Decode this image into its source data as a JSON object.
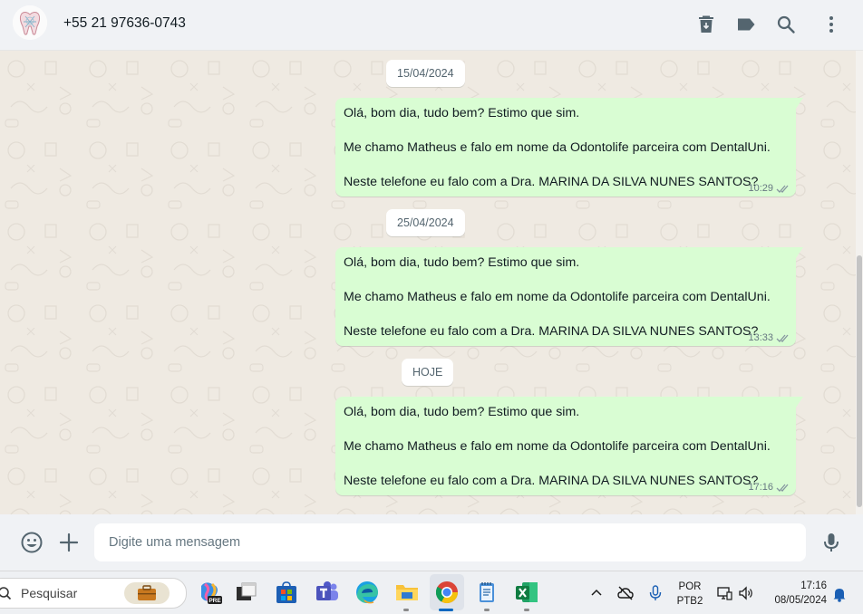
{
  "header": {
    "contact_name": "+55 21 97636-0743",
    "icons": [
      "delete-chat-icon",
      "label-icon",
      "search-icon",
      "menu-icon"
    ]
  },
  "chat": {
    "groups": [
      {
        "date": "15/04/2024",
        "message": {
          "lines": [
            "Olá, bom dia, tudo bem? Estimo que sim.",
            "Me chamo Matheus e falo em nome da Odontolife parceira com DentalUni.",
            "Neste telefone eu falo com a Dra. MARINA DA SILVA NUNES SANTOS?"
          ],
          "time": "10:29",
          "status": "delivered"
        }
      },
      {
        "date": "25/04/2024",
        "message": {
          "lines": [
            "Olá, bom dia, tudo bem? Estimo que sim.",
            "Me chamo Matheus e falo em nome da Odontolife parceira com DentalUni.",
            "Neste telefone eu falo com a Dra. MARINA DA SILVA NUNES SANTOS?"
          ],
          "time": "13:33",
          "status": "delivered"
        }
      },
      {
        "date": "HOJE",
        "message": {
          "lines": [
            "Olá, bom dia, tudo bem? Estimo que sim.",
            "Me chamo Matheus e falo em nome da Odontolife parceira com DentalUni.",
            "Neste telefone eu falo com a Dra. MARINA DA SILVA NUNES SANTOS?"
          ],
          "time": "17:16",
          "status": "delivered"
        }
      }
    ]
  },
  "composer": {
    "placeholder": "Digite uma mensagem",
    "value": "",
    "icons": [
      "emoji-icon",
      "attach-plus-icon",
      "microphone-icon"
    ]
  },
  "taskbar": {
    "search_label": "Pesquisar",
    "apps": [
      "briefcase-widget",
      "copilot-pre",
      "desktop-app",
      "microsoft-store",
      "teams",
      "edge",
      "file-explorer",
      "chrome",
      "notepad",
      "excel"
    ],
    "language": "POR",
    "keyboard": "PTB2",
    "time": "17:16",
    "date": "08/05/2024"
  },
  "colors": {
    "outgoing_bubble": "#d9fdd3",
    "chat_background": "#efeae2",
    "header_background": "#f0f2f5",
    "read_tick": "#8696a0"
  }
}
